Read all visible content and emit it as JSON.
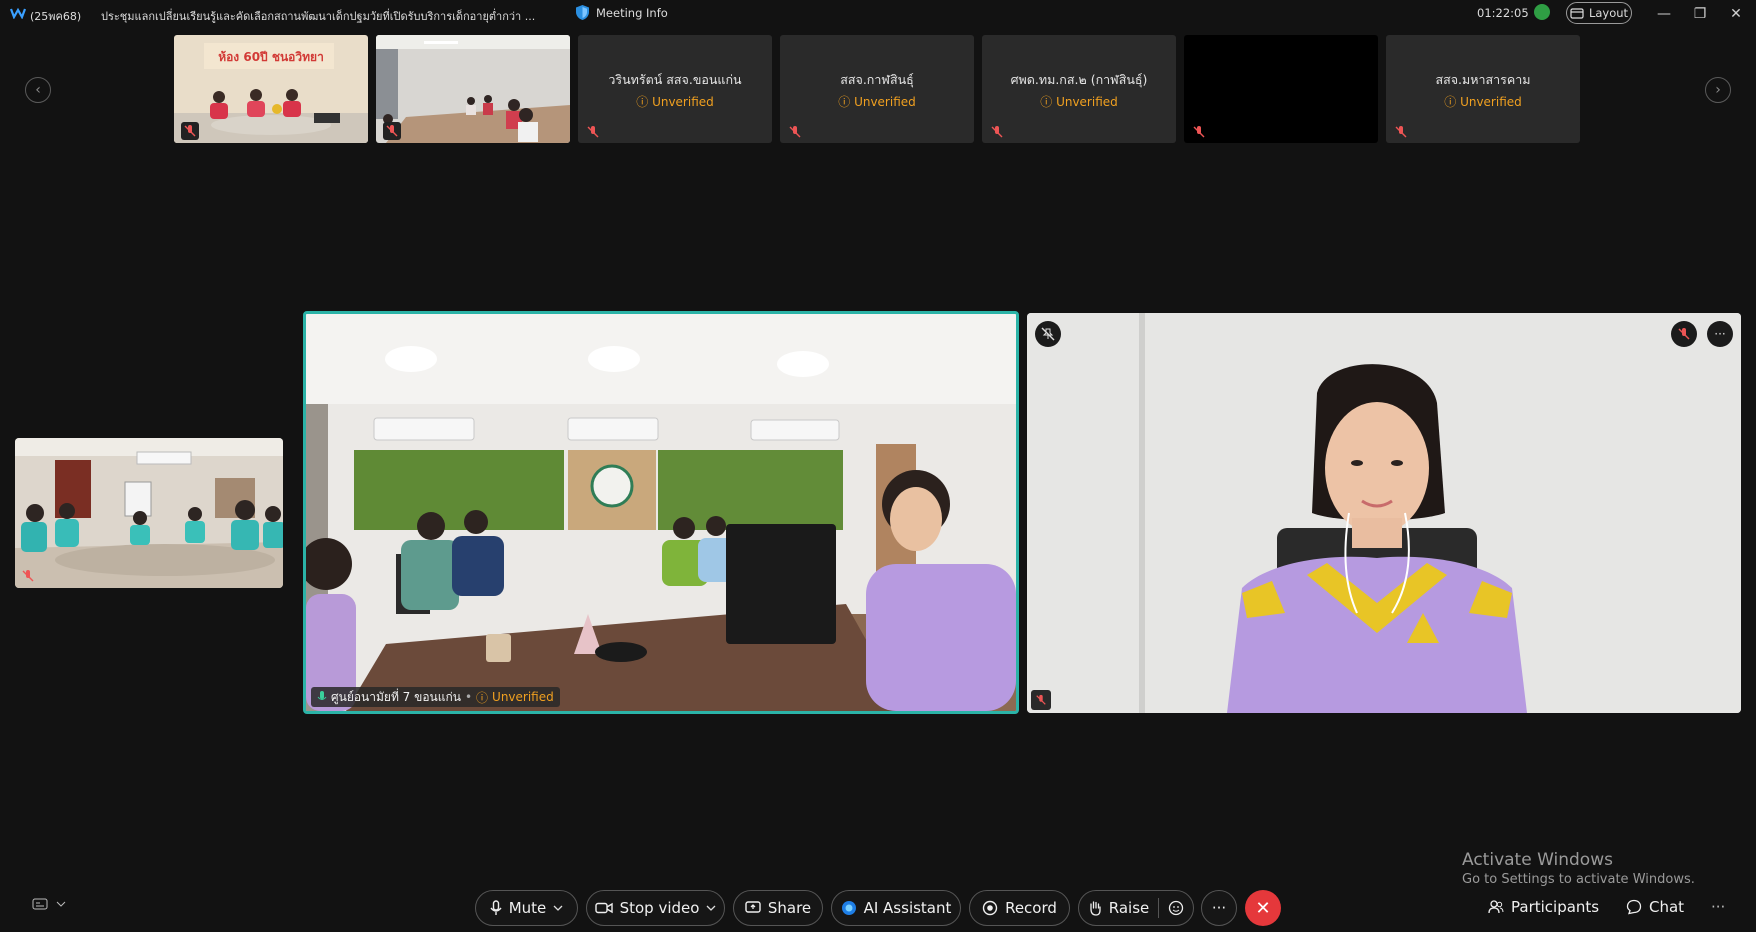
{
  "window": {
    "code": "(25พค68)",
    "title": "ประชุมแลกเปลี่ยนเรียนรู้และคัดเลือกสถานพัฒนาเด็กปฐมวัยที่เปิดรับบริการเด็กอายุต่ำกว่า ...",
    "meeting_info_label": "Meeting Info",
    "timer": "01:22:05",
    "layout_label": "Layout",
    "minimize_icon": "—",
    "restore_icon": "❐",
    "close_icon": "✕"
  },
  "filmstrip": {
    "prev_icon": "‹",
    "next_icon": "›",
    "tiles": [
      {
        "type": "video",
        "caption": "ห้อง 60ปี ชนอวิทยา"
      },
      {
        "type": "video"
      },
      {
        "type": "name",
        "name": "วรินทรัตน์ สสจ.ขอนแก่น",
        "status": "Unverified"
      },
      {
        "type": "name",
        "name": "สสจ.กาฬสินธุ์",
        "status": "Unverified"
      },
      {
        "type": "name",
        "name": "ศพด.ทม.กส.๒ (กาฬสินธุ์)",
        "status": "Unverified"
      },
      {
        "type": "black"
      },
      {
        "type": "name",
        "name": "สสจ.มหาสารคาม",
        "status": "Unverified"
      }
    ]
  },
  "main": {
    "speaker_label": "ศูนย์อนามัยที่ 7 ขอนแก่น",
    "speaker_status": "Unverified",
    "more_icon": "···"
  },
  "watermark": {
    "line1": "Activate Windows",
    "line2": "Go to Settings to activate Windows."
  },
  "toolbar": {
    "mute": "Mute",
    "stop_video": "Stop video",
    "share": "Share",
    "ai_assistant": "AI Assistant",
    "record": "Record",
    "raise": "Raise",
    "more": "···",
    "end": "✕",
    "participants": "Participants",
    "chat": "Chat",
    "overflow": "···"
  },
  "colors": {
    "active_border": "#2bb3a7",
    "unverified": "#f0a020",
    "end_call": "#e5383b",
    "recording": "#2f9e44"
  }
}
